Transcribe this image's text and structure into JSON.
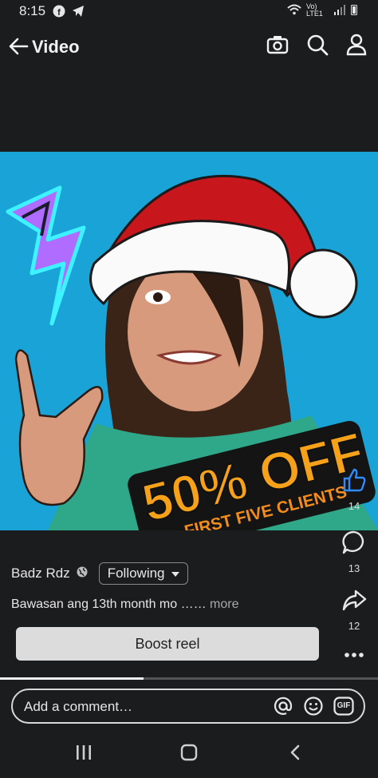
{
  "status_bar": {
    "time": "8:15",
    "network": "Vo) LTE1",
    "icons": [
      "facebook-icon",
      "telegram-icon",
      "wifi-icon",
      "signal-icon",
      "battery-icon"
    ]
  },
  "header": {
    "title": "Video",
    "icons": [
      "back-arrow-icon",
      "camera-icon",
      "search-icon",
      "profile-icon"
    ]
  },
  "video": {
    "overlay_text": {
      "headline": "50% OFF",
      "subline": "FIRST FIVE CLIENTS"
    },
    "colors": {
      "background": "#19a3d6",
      "hat": "#c8161d",
      "headline_orange": "#f5a11a"
    }
  },
  "rail": {
    "like_count": "14",
    "comment_count": "13",
    "share_count": "12",
    "icons": [
      "like-icon",
      "comment-icon",
      "share-icon",
      "more-icon"
    ]
  },
  "post": {
    "author": "Badz Rdz",
    "follow_label": "Following",
    "caption": "Bawasan ang 13th month mo ……",
    "more_label": "more",
    "boost_label": "Boost reel"
  },
  "playback": {
    "progress": 0.38
  },
  "comment_box": {
    "placeholder": "Add a comment…",
    "gif_label": "GIF"
  },
  "nav": {
    "icons": [
      "recents-icon",
      "home-icon",
      "back-icon"
    ]
  }
}
